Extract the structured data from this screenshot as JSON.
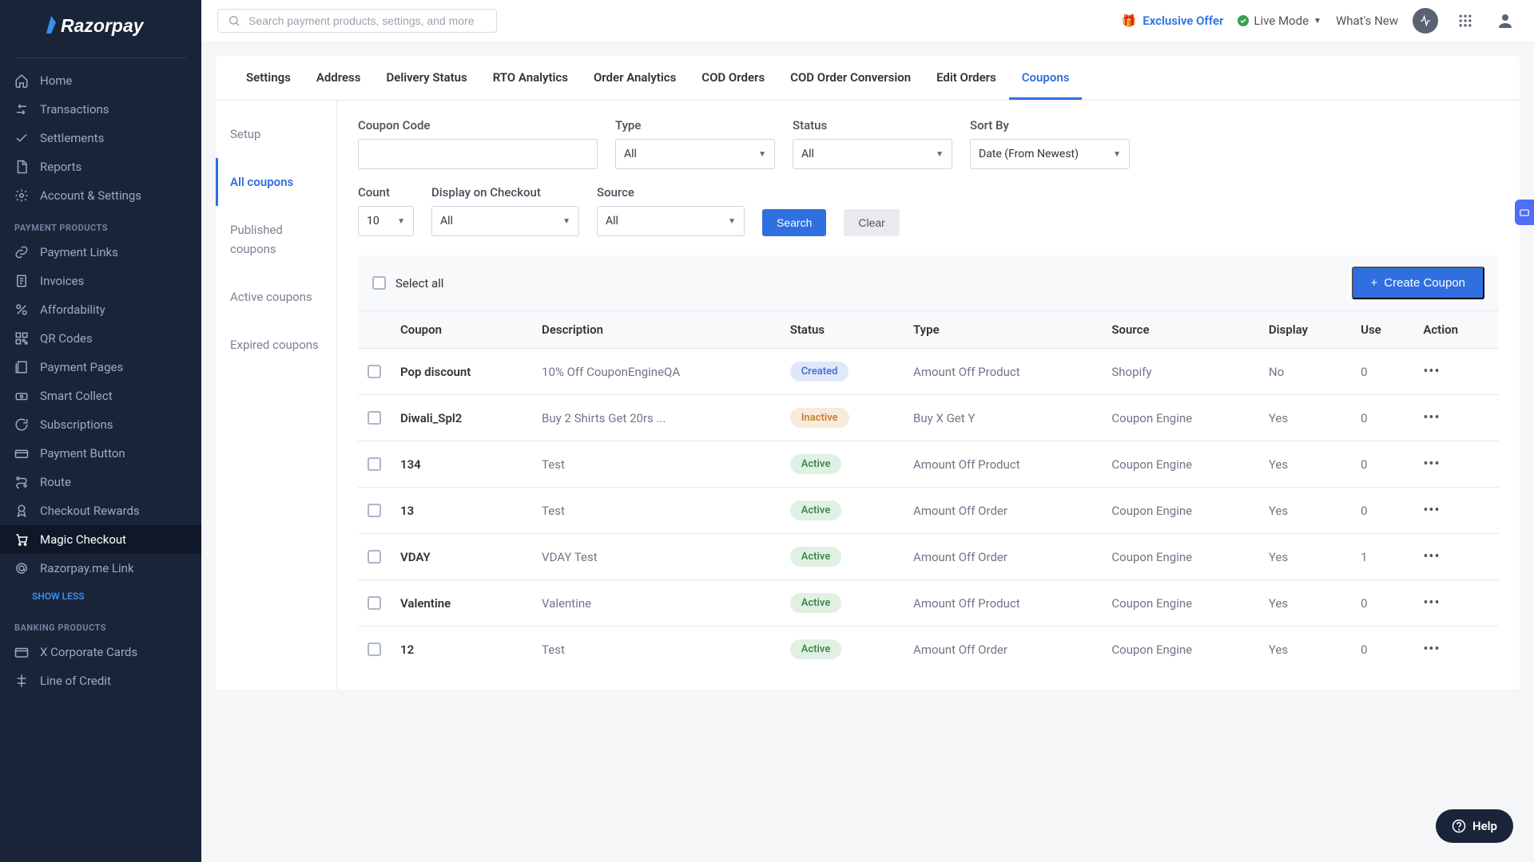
{
  "brand": "Razorpay",
  "topbar": {
    "search_placeholder": "Search payment products, settings, and more",
    "exclusive_offer": "Exclusive Offer",
    "live_mode": "Live Mode",
    "whats_new": "What's New"
  },
  "sidebar": {
    "main_items": [
      {
        "label": "Home",
        "icon": "home",
        "active": false
      },
      {
        "label": "Transactions",
        "icon": "swap",
        "active": false
      },
      {
        "label": "Settlements",
        "icon": "check",
        "active": false
      },
      {
        "label": "Reports",
        "icon": "file",
        "active": false
      },
      {
        "label": "Account & Settings",
        "icon": "gear",
        "active": false
      }
    ],
    "section_products": "PAYMENT PRODUCTS",
    "product_items": [
      {
        "label": "Payment Links",
        "icon": "link"
      },
      {
        "label": "Invoices",
        "icon": "invoice"
      },
      {
        "label": "Affordability",
        "icon": "percent"
      },
      {
        "label": "QR Codes",
        "icon": "qr"
      },
      {
        "label": "Payment Pages",
        "icon": "pages"
      },
      {
        "label": "Smart Collect",
        "icon": "collect"
      },
      {
        "label": "Subscriptions",
        "icon": "subs"
      },
      {
        "label": "Payment Button",
        "icon": "pay"
      },
      {
        "label": "Route",
        "icon": "route"
      },
      {
        "label": "Checkout Rewards",
        "icon": "rewards"
      },
      {
        "label": "Magic Checkout",
        "icon": "cart",
        "active": true
      },
      {
        "label": "Razorpay.me Link",
        "icon": "at"
      }
    ],
    "show_less": "SHOW LESS",
    "section_banking": "BANKING PRODUCTS",
    "banking_items": [
      {
        "label": "X Corporate Cards",
        "icon": "card"
      },
      {
        "label": "Line of Credit",
        "icon": "credit"
      }
    ]
  },
  "tabs": [
    {
      "label": "Settings"
    },
    {
      "label": "Address"
    },
    {
      "label": "Delivery Status"
    },
    {
      "label": "RTO Analytics"
    },
    {
      "label": "Order Analytics"
    },
    {
      "label": "COD Orders"
    },
    {
      "label": "COD Order Conversion"
    },
    {
      "label": "Edit Orders"
    },
    {
      "label": "Coupons",
      "active": true
    }
  ],
  "subnav": [
    {
      "label": "Setup"
    },
    {
      "label": "All coupons",
      "active": true
    },
    {
      "label": "Published coupons"
    },
    {
      "label": "Active coupons"
    },
    {
      "label": "Expired coupons"
    }
  ],
  "filters": {
    "coupon_code_label": "Coupon Code",
    "type_label": "Type",
    "type_value": "All",
    "status_label": "Status",
    "status_value": "All",
    "sort_label": "Sort By",
    "sort_value": "Date (From Newest)",
    "count_label": "Count",
    "count_value": "10",
    "display_label": "Display on Checkout",
    "display_value": "All",
    "source_label": "Source",
    "source_value": "All",
    "search_btn": "Search",
    "clear_btn": "Clear"
  },
  "table": {
    "select_all": "Select all",
    "create_btn": "Create Coupon",
    "headers": [
      "Coupon",
      "Description",
      "Status",
      "Type",
      "Source",
      "Display",
      "Use",
      "Action"
    ],
    "rows": [
      {
        "coupon": "Pop discount",
        "desc": "10% Off CouponEngineQA",
        "status": "Created",
        "status_class": "created",
        "type": "Amount Off Product",
        "source": "Shopify",
        "display": "No",
        "use": "0"
      },
      {
        "coupon": "Diwali_Spl2",
        "desc": "Buy 2 Shirts Get 20rs ...",
        "status": "Inactive",
        "status_class": "inactive",
        "type": "Buy X Get Y",
        "source": "Coupon Engine",
        "display": "Yes",
        "use": "0"
      },
      {
        "coupon": "134",
        "desc": "Test",
        "status": "Active",
        "status_class": "active",
        "type": "Amount Off Product",
        "source": "Coupon Engine",
        "display": "Yes",
        "use": "0"
      },
      {
        "coupon": "13",
        "desc": "Test",
        "status": "Active",
        "status_class": "active",
        "type": "Amount Off Order",
        "source": "Coupon Engine",
        "display": "Yes",
        "use": "0"
      },
      {
        "coupon": "VDAY",
        "desc": "VDAY Test",
        "status": "Active",
        "status_class": "active",
        "type": "Amount Off Order",
        "source": "Coupon Engine",
        "display": "Yes",
        "use": "1"
      },
      {
        "coupon": "Valentine",
        "desc": "Valentine",
        "status": "Active",
        "status_class": "active",
        "type": "Amount Off Product",
        "source": "Coupon Engine",
        "display": "Yes",
        "use": "0"
      },
      {
        "coupon": "12",
        "desc": "Test",
        "status": "Active",
        "status_class": "active",
        "type": "Amount Off Order",
        "source": "Coupon Engine",
        "display": "Yes",
        "use": "0"
      }
    ]
  },
  "help": "Help"
}
